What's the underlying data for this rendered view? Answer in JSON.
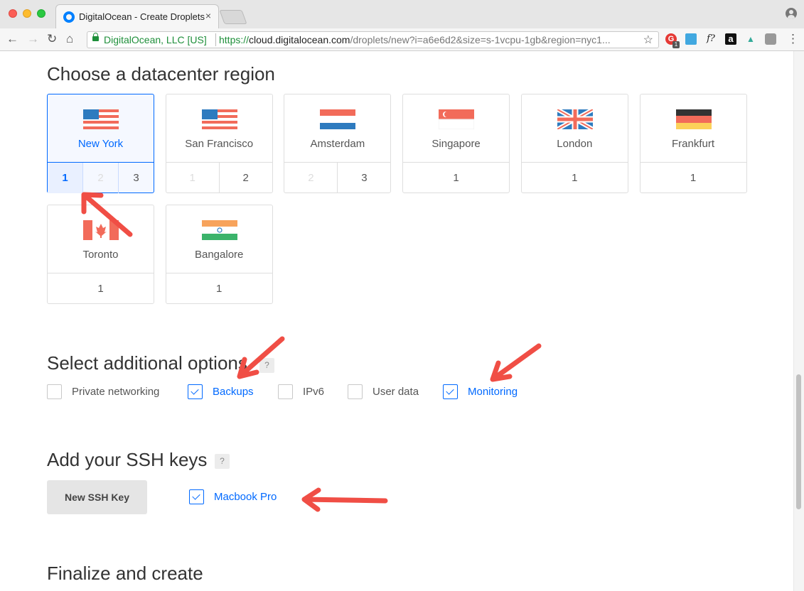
{
  "browser": {
    "tab_title": "DigitalOcean - Create Droplets",
    "tab_close": "×",
    "ev_name": "DigitalOcean, LLC [US]",
    "url_scheme": "https://",
    "url_host": "cloud.digitalocean.com",
    "url_path": "/droplets/new?i=a6e6d2&size=s-1vcpu-1gb&region=nyc1...",
    "extensions": {
      "ext1_label": "G",
      "ext1_badge": "1",
      "ext3_label": "f?",
      "ext4_label": "a"
    }
  },
  "region_section": {
    "heading": "Choose a datacenter region",
    "regions": [
      {
        "name": "New York",
        "flag": "us-flag-icon",
        "selected": true,
        "datacenters": [
          {
            "label": "1",
            "state": "active"
          },
          {
            "label": "2",
            "state": "disabled"
          },
          {
            "label": "3",
            "state": "normal"
          }
        ]
      },
      {
        "name": "San Francisco",
        "flag": "us-flag-icon",
        "selected": false,
        "datacenters": [
          {
            "label": "1",
            "state": "disabled"
          },
          {
            "label": "2",
            "state": "normal"
          }
        ]
      },
      {
        "name": "Amsterdam",
        "flag": "nl-flag-icon",
        "selected": false,
        "datacenters": [
          {
            "label": "2",
            "state": "disabled"
          },
          {
            "label": "3",
            "state": "normal"
          }
        ]
      },
      {
        "name": "Singapore",
        "flag": "sg-flag-icon",
        "selected": false,
        "datacenters": [
          {
            "label": "1",
            "state": "normal"
          }
        ]
      },
      {
        "name": "London",
        "flag": "uk-flag-icon",
        "selected": false,
        "datacenters": [
          {
            "label": "1",
            "state": "normal"
          }
        ]
      },
      {
        "name": "Frankfurt",
        "flag": "de-flag-icon",
        "selected": false,
        "datacenters": [
          {
            "label": "1",
            "state": "normal"
          }
        ]
      },
      {
        "name": "Toronto",
        "flag": "ca-flag-icon",
        "selected": false,
        "datacenters": [
          {
            "label": "1",
            "state": "normal"
          }
        ]
      },
      {
        "name": "Bangalore",
        "flag": "in-flag-icon",
        "selected": false,
        "datacenters": [
          {
            "label": "1",
            "state": "normal"
          }
        ]
      }
    ]
  },
  "options_section": {
    "heading": "Select additional options",
    "help": "?",
    "options": [
      {
        "label": "Private networking",
        "checked": false
      },
      {
        "label": "Backups",
        "checked": true
      },
      {
        "label": "IPv6",
        "checked": false
      },
      {
        "label": "User data",
        "checked": false
      },
      {
        "label": "Monitoring",
        "checked": true
      }
    ]
  },
  "ssh_section": {
    "heading": "Add your SSH keys",
    "help": "?",
    "new_key_button": "New SSH Key",
    "keys": [
      {
        "label": "Macbook Pro",
        "checked": true
      }
    ]
  },
  "finalize_section": {
    "heading": "Finalize and create"
  },
  "colors": {
    "accent": "#0069ff",
    "annotation_arrow": "#f04e45",
    "ev_green": "#1e8f3a"
  }
}
